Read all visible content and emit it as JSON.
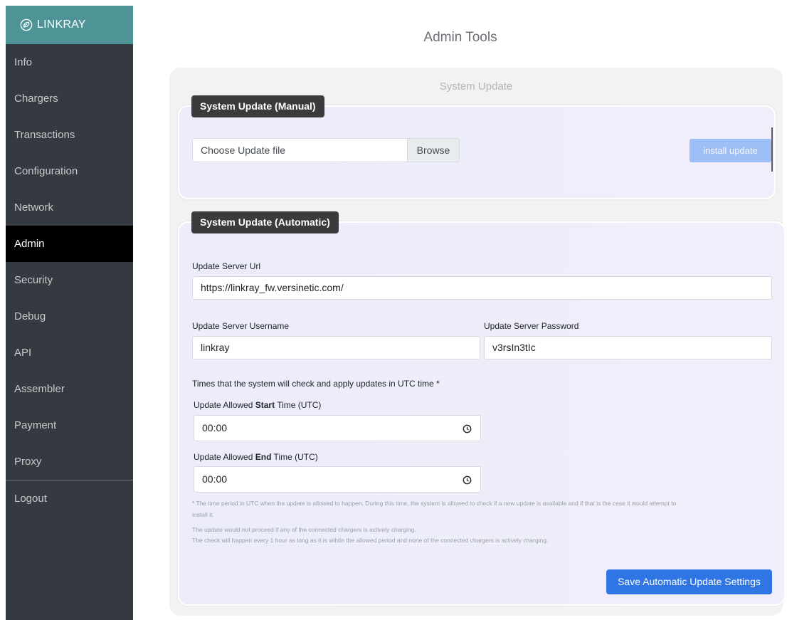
{
  "brand": {
    "name": "LINKRAY",
    "icon": "leaf-circle-icon"
  },
  "sidebar": {
    "items": [
      {
        "label": "Info"
      },
      {
        "label": "Chargers"
      },
      {
        "label": "Transactions"
      },
      {
        "label": "Configuration"
      },
      {
        "label": "Network"
      },
      {
        "label": "Admin"
      },
      {
        "label": "Security"
      },
      {
        "label": "Debug"
      },
      {
        "label": "API"
      },
      {
        "label": "Assembler"
      },
      {
        "label": "Payment"
      },
      {
        "label": "Proxy"
      }
    ],
    "logout": "Logout",
    "active": "Admin"
  },
  "page": {
    "title": "Admin Tools"
  },
  "system_update": {
    "title": "System Update",
    "manual": {
      "badge": "System Update (Manual)",
      "file_placeholder": "Choose Update file",
      "browse_label": "Browse",
      "install_label": "install update"
    },
    "automatic": {
      "badge": "System Update (Automatic)",
      "url_label": "Update Server Url",
      "url_value": "https://linkray_fw.versinetic.com/",
      "username_label": "Update Server Username",
      "username_value": "linkray",
      "password_label": "Update Server Password",
      "password_value": "v3rsIn3tIc",
      "times_intro": "Times that the system will check and apply updates in UTC time *",
      "start_label_pre": "Update Allowed ",
      "start_label_bold": "Start",
      "start_label_post": " Time (UTC)",
      "start_value": "00:00",
      "end_label_pre": "Update Allowed ",
      "end_label_bold": "End",
      "end_label_post": " Time (UTC)",
      "end_value": "00:00",
      "note_line1": "* The time period in UTC when the update is allowed to happen. During this time, the system is allowed to check if a new update is available and if that is the case it would attempt to",
      "note_line2": "install it.",
      "note_line3": "The update would not proceed if any of the connected chargers is actively charging.",
      "note_line4": "The check will happen every 1 hour as long as it is wihtin the allowed period and none of the connected chargers is actively charging.",
      "save_label": "Save Automatic Update Settings"
    }
  },
  "colors": {
    "sidebar_bg": "#343a40",
    "brand_bg": "#4e9497",
    "active_bg": "#000000",
    "primary_button": "#2f75e3",
    "install_button_disabled": "#9ebff5",
    "badge_bg": "#3a3b3c"
  }
}
